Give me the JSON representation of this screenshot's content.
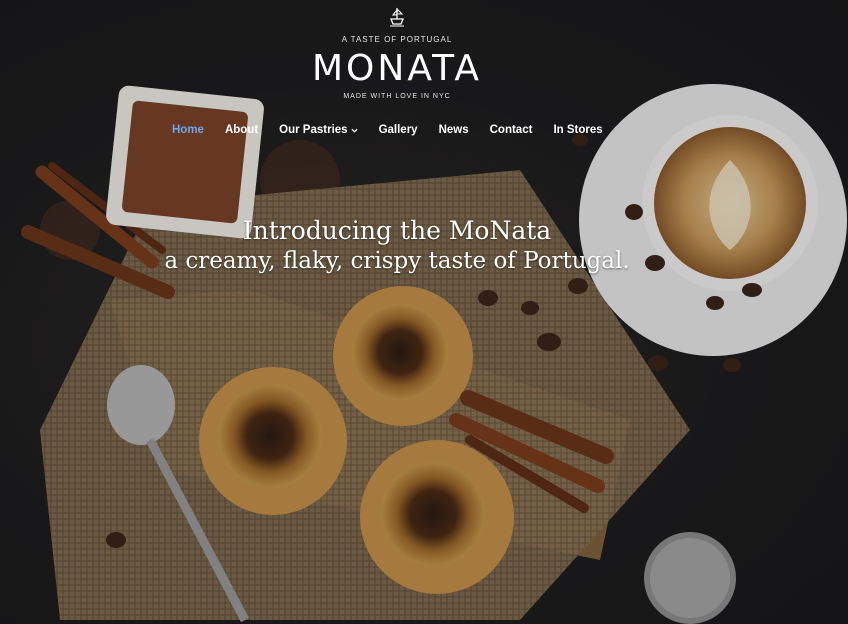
{
  "header": {
    "tagline_top": "A TASTE  OF PORTUGAL",
    "brand": "MONATA",
    "tagline_bottom": "MADE WITH LOVE IN NYC"
  },
  "nav": {
    "items": [
      {
        "label": "Home",
        "active": true
      },
      {
        "label": "About"
      },
      {
        "label": "Our Pastries",
        "has_dropdown": true
      },
      {
        "label": "Gallery"
      },
      {
        "label": "News"
      },
      {
        "label": "Contact"
      },
      {
        "label": "In Stores"
      }
    ]
  },
  "hero": {
    "headline_line1": "Introducing the MoNata",
    "headline_line2": "a creamy, flaky, crispy taste of Portugal."
  },
  "colors": {
    "background": "#1b1b1d",
    "nav_active": "#6ea8e8",
    "text": "#ffffff"
  },
  "icons": [
    "ship-emblem-icon",
    "chevron-down-icon"
  ]
}
